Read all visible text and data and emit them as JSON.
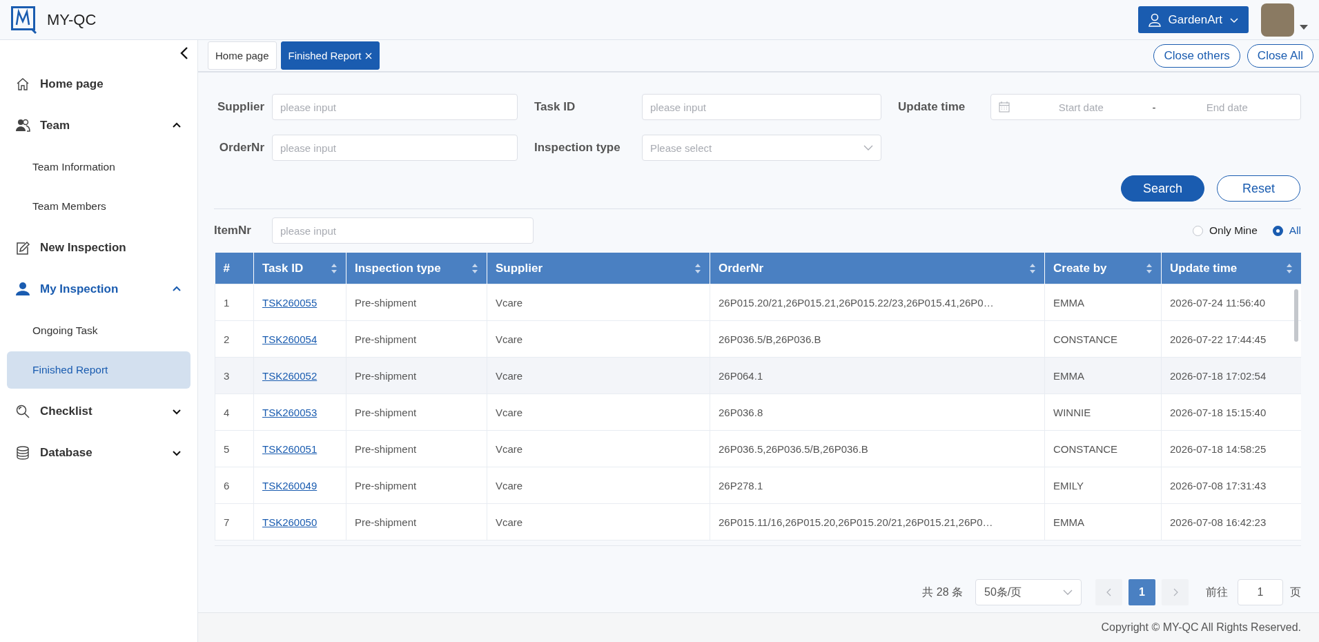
{
  "app": {
    "title": "MY-QC"
  },
  "user_menu": {
    "label": "GardenArt"
  },
  "sidebar": {
    "items": [
      {
        "kind": "link",
        "label": "Home page"
      },
      {
        "kind": "group",
        "label": "Team",
        "expanded": true,
        "children": [
          {
            "label": "Team Information",
            "selected": false
          },
          {
            "label": "Team Members",
            "selected": false
          }
        ]
      },
      {
        "kind": "link",
        "label": "New Inspection"
      },
      {
        "kind": "group",
        "label": "My Inspection",
        "expanded": true,
        "children": [
          {
            "label": "Ongoing Task",
            "selected": false
          },
          {
            "label": "Finished Report",
            "selected": true
          }
        ]
      },
      {
        "kind": "group",
        "label": "Checklist",
        "expanded": false
      },
      {
        "kind": "group",
        "label": "Database",
        "expanded": false
      }
    ]
  },
  "tabs": [
    {
      "label": "Home page",
      "selected": false,
      "closable": false
    },
    {
      "label": "Finished Report",
      "selected": true,
      "closable": true
    }
  ],
  "tab_actions": [
    "Close others",
    "Close All"
  ],
  "filters": [
    {
      "kind": "text",
      "label": "Supplier",
      "placeholder": "please input"
    },
    {
      "kind": "text",
      "label": "Task ID",
      "placeholder": "please input"
    },
    {
      "kind": "daterange",
      "label": "Update time",
      "start_placeholder": "Start date",
      "separator": "-",
      "end_placeholder": "End date"
    },
    {
      "kind": "text",
      "label": "OrderNr",
      "placeholder": "please input"
    },
    {
      "kind": "select",
      "label": "Inspection type",
      "placeholder": "Please select"
    }
  ],
  "buttons": [
    {
      "kind": "primary",
      "label": "Search"
    },
    {
      "kind": "plain",
      "label": "Reset"
    }
  ],
  "item_filter": {
    "label": "ItemNr",
    "placeholder": "please input"
  },
  "scope_options": [
    {
      "label": "Only Mine",
      "selected": false
    },
    {
      "label": "All",
      "selected": true
    }
  ],
  "table": {
    "columns": [
      {
        "label": "#",
        "kind": "index",
        "sortable": false
      },
      {
        "label": "Task ID",
        "kind": "link",
        "sortable": true
      },
      {
        "label": "Inspection type",
        "kind": "text",
        "sortable": true
      },
      {
        "label": "Supplier",
        "kind": "text",
        "sortable": true
      },
      {
        "label": "OrderNr",
        "kind": "text",
        "sortable": true
      },
      {
        "label": "Create by",
        "kind": "text",
        "sortable": true
      },
      {
        "label": "Update time",
        "kind": "text",
        "sortable": true
      }
    ],
    "rows": [
      {
        "highlighted": false,
        "cells": [
          "1",
          "TSK260055",
          "Pre-shipment",
          "Vcare",
          "26P015.20/21,26P015.21,26P015.22/23,26P015.41,26P0…",
          "EMMA",
          "2026-07-24 11:56:40"
        ]
      },
      {
        "highlighted": false,
        "cells": [
          "2",
          "TSK260054",
          "Pre-shipment",
          "Vcare",
          "26P036.5/B,26P036.B",
          "CONSTANCE",
          "2026-07-22 17:44:45"
        ]
      },
      {
        "highlighted": true,
        "cells": [
          "3",
          "TSK260052",
          "Pre-shipment",
          "Vcare",
          "26P064.1",
          "EMMA",
          "2026-07-18 17:02:54"
        ]
      },
      {
        "highlighted": false,
        "cells": [
          "4",
          "TSK260053",
          "Pre-shipment",
          "Vcare",
          "26P036.8",
          "WINNIE",
          "2026-07-18 15:15:40"
        ]
      },
      {
        "highlighted": false,
        "cells": [
          "5",
          "TSK260051",
          "Pre-shipment",
          "Vcare",
          "26P036.5,26P036.5/B,26P036.B",
          "CONSTANCE",
          "2026-07-18 14:58:25"
        ]
      },
      {
        "highlighted": false,
        "cells": [
          "6",
          "TSK260049",
          "Pre-shipment",
          "Vcare",
          "26P278.1",
          "EMILY",
          "2026-07-08 17:31:43"
        ]
      },
      {
        "highlighted": false,
        "cells": [
          "7",
          "TSK260050",
          "Pre-shipment",
          "Vcare",
          "26P015.11/16,26P015.20,26P015.20/21,26P015.21,26P0…",
          "EMMA",
          "2026-07-08 16:42:23"
        ]
      }
    ]
  },
  "pagination": {
    "total": "共 28 条",
    "page_size": "50条/页",
    "pages": [
      {
        "label": "1",
        "selected": true
      }
    ],
    "goto_label": "前往",
    "goto_value": "1",
    "page_suffix": "页"
  },
  "footer": {
    "text": "Copyright © MY-QC All Rights Reserved."
  }
}
